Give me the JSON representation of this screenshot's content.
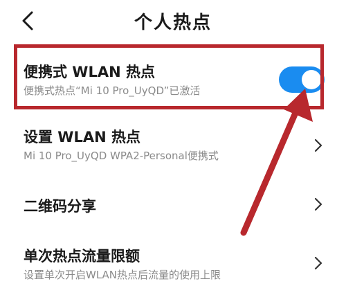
{
  "header": {
    "title": "个人热点"
  },
  "rows": [
    {
      "title": "便携式 WLAN 热点",
      "subtitle": "便携式热点“Mi 10 Pro_UyQD”已激活"
    },
    {
      "title": "设置 WLAN 热点",
      "subtitle": "Mi 10 Pro_UyQD WPA2-Personal便携式"
    },
    {
      "title": "二维码分享"
    },
    {
      "title": "单次热点流量限额",
      "subtitle": "设置单次开启WLAN热点后流量的使用上限"
    }
  ],
  "toggle": {
    "state": "on",
    "color": "#1a8cf0"
  },
  "annotation": {
    "box_color": "#b8282d",
    "arrow_color": "#b8282d"
  },
  "icons": {
    "back": "chevron-left-icon",
    "forward": "chevron-right-icon"
  }
}
